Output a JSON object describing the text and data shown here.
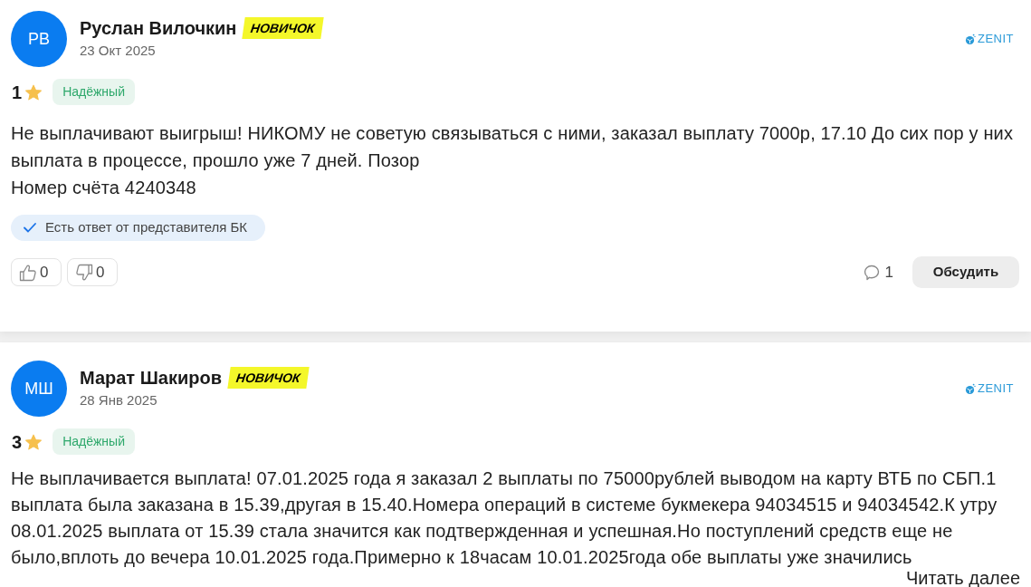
{
  "reviews": [
    {
      "author": {
        "initials": "РВ",
        "name": "Руслан Вилочкин",
        "badge": "НОВИЧОК"
      },
      "date": "23 Окт 2025",
      "bookmaker": "ZENIT",
      "rating": "1",
      "status_tag": "Надёжный",
      "text": "Не выплачивают выигрыш! НИКОМУ не советую связываться с ними, заказал выплату 7000р, 17.10 До сих пор у них выплата в процессе, прошло уже 7 дней. Позор\nНомер счёта 4240348",
      "rep_answer": "Есть ответ от представителя БК",
      "likes": "0",
      "dislikes": "0",
      "comments": "1",
      "discuss_button": "Обсудить"
    },
    {
      "author": {
        "initials": "МШ",
        "name": "Марат Шакиров",
        "badge": "НОВИЧОК"
      },
      "date": "28 Янв 2025",
      "bookmaker": "ZENIT",
      "rating": "3",
      "status_tag": "Надёжный",
      "text": "Не выплачивается выплата! 07.01.2025 года я заказал 2 выплаты по 75000рублей выводом на карту ВТБ по СБП.1 выплата была заказана в 15.39,другая в 15.40.Номера операций в системе букмекера 94034515 и 94034542.К утру 08.01.2025 выплата от 15.39 стала значится как подтвержденная и успешная.Но поступлений средств еще не было,вплоть до вечера 10.01.2025 года.Примерно к 18часам 10.01.2025года обе выплаты уже значились",
      "read_more": "Читать далее"
    }
  ]
}
